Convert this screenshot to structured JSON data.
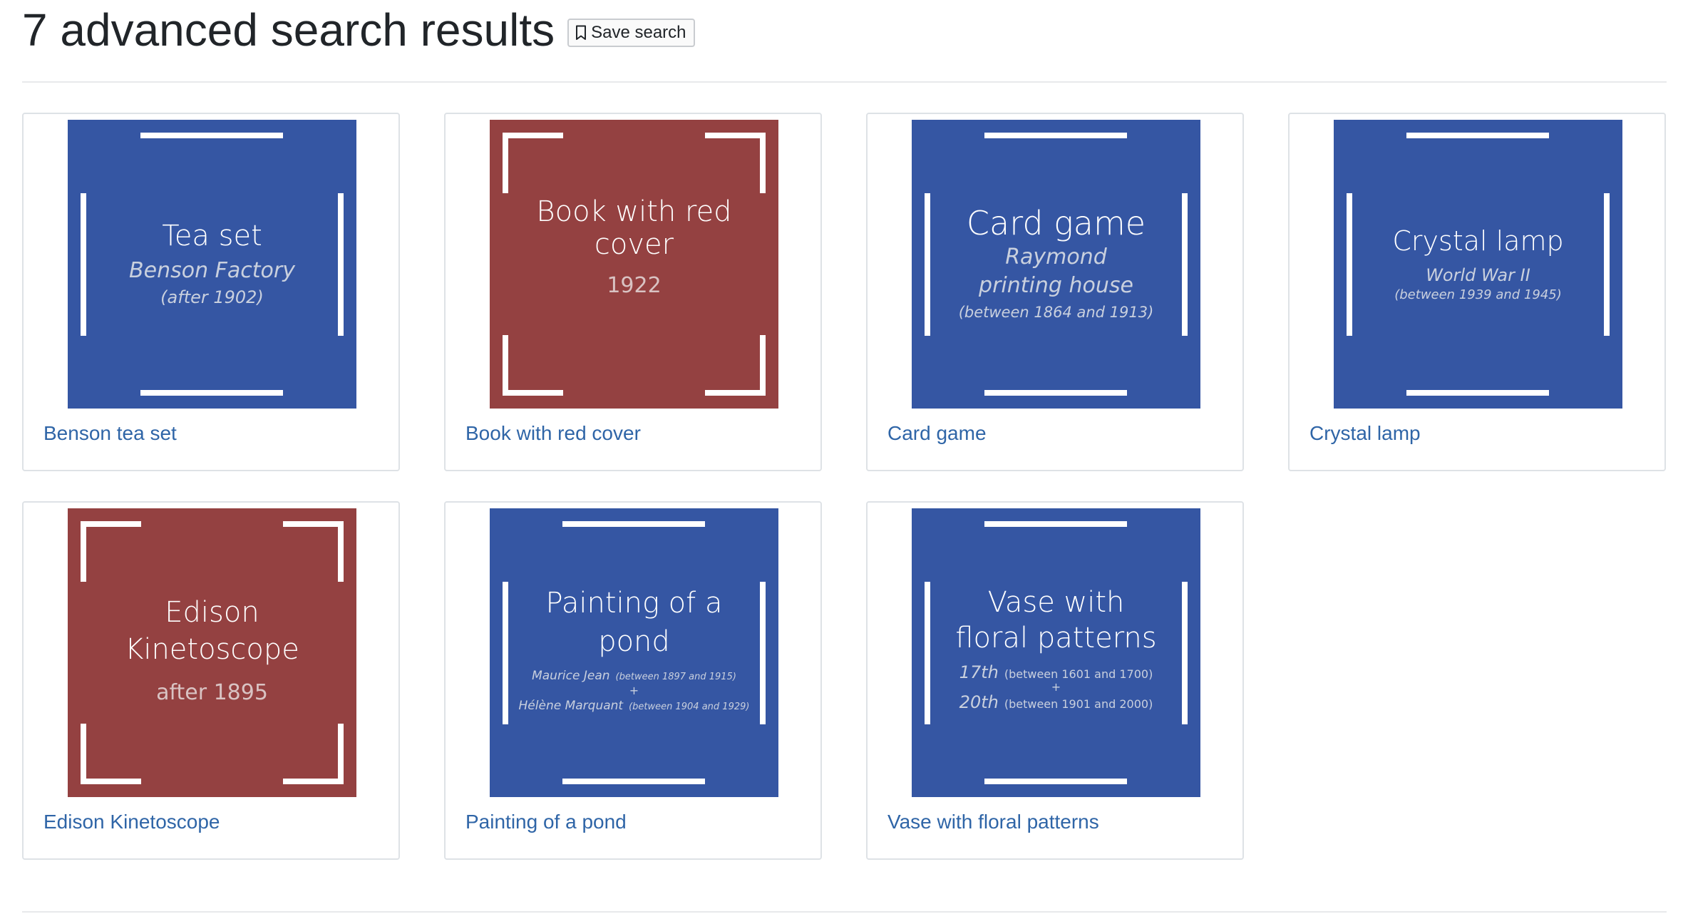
{
  "header": {
    "title": "7 advanced search results",
    "save_label": "Save search"
  },
  "icons": {
    "save": "bookmark-icon"
  },
  "colors": {
    "blue_thumb": "#3556a3",
    "red_thumb": "#944141",
    "link": "#2f65a7"
  },
  "results": [
    {
      "link": "Benson tea set",
      "thumb": {
        "title": "Tea set",
        "sub": "Benson Factory",
        "date": "(after 1902)"
      }
    },
    {
      "link": "Book with red cover",
      "thumb": {
        "title_line1": "Book with red",
        "title_line2": "cover",
        "date": "1922"
      }
    },
    {
      "link": "Card game",
      "thumb": {
        "title": "Card game",
        "sub_line1": "Raymond",
        "sub_line2": "printing house",
        "date": "(between 1864 and 1913)"
      }
    },
    {
      "link": "Crystal lamp",
      "thumb": {
        "title": "Crystal lamp",
        "sub": "World War II",
        "date": "(between 1939 and 1945)"
      }
    },
    {
      "link": "Edison Kinetoscope",
      "thumb": {
        "title_line1": "Edison",
        "title_line2": "Kinetoscope",
        "date": "after 1895"
      }
    },
    {
      "link": "Painting of a pond",
      "thumb": {
        "title_line1": "Painting of a",
        "title_line2": "pond",
        "person1": "Maurice Jean",
        "person1_date": "(between 1897 and 1915)",
        "plus": "+",
        "person2": "Hélène Marquant",
        "person2_date": "(between 1904 and 1929)"
      }
    },
    {
      "link": "Vase with floral patterns",
      "thumb": {
        "title_line1": "Vase with",
        "title_line2": "floral patterns",
        "century1": "17th",
        "century1_date": "(between 1601 and 1700)",
        "plus": "+",
        "century2": "20th",
        "century2_date": "(between 1901 and 2000)"
      }
    }
  ]
}
